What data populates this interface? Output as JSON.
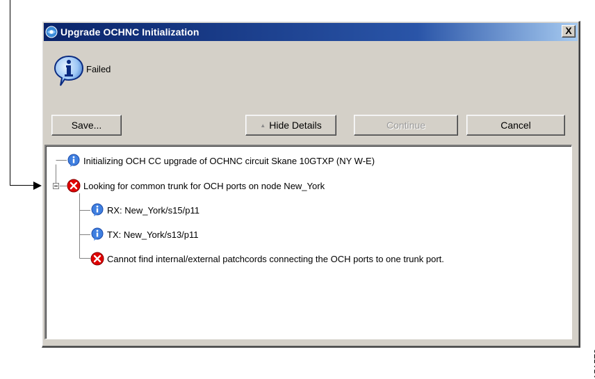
{
  "window": {
    "title": "Upgrade OCHNC Initialization",
    "close_label": "X"
  },
  "status": {
    "icon": "info-icon",
    "text": "Failed"
  },
  "buttons": {
    "save": "Save...",
    "hide_details": "Hide Details",
    "hide_details_icon": "triangle-up-icon",
    "continue": "Continue",
    "continue_enabled": false,
    "cancel": "Cancel"
  },
  "details": {
    "items": [
      {
        "type": "info",
        "text": "Initializing OCH CC upgrade of OCHNC circuit Skane 10GTXP (NY W-E)"
      },
      {
        "type": "error",
        "text": "Looking for common trunk for OCH ports on node New_York",
        "expanded": true,
        "children": [
          {
            "type": "info",
            "text": "RX: New_York/s15/p11"
          },
          {
            "type": "info",
            "text": "TX: New_York/s13/p11"
          },
          {
            "type": "error",
            "text": "Cannot find internal/external patchcords connecting the OCH ports to one trunk port."
          }
        ]
      }
    ]
  },
  "figure_id": "151572",
  "colors": {
    "titlebar_start": "#0a246a",
    "titlebar_end": "#a6caf0",
    "info_icon": "#2e6fd8",
    "error_icon": "#d90000",
    "dialog_bg": "#d4d0c8"
  }
}
